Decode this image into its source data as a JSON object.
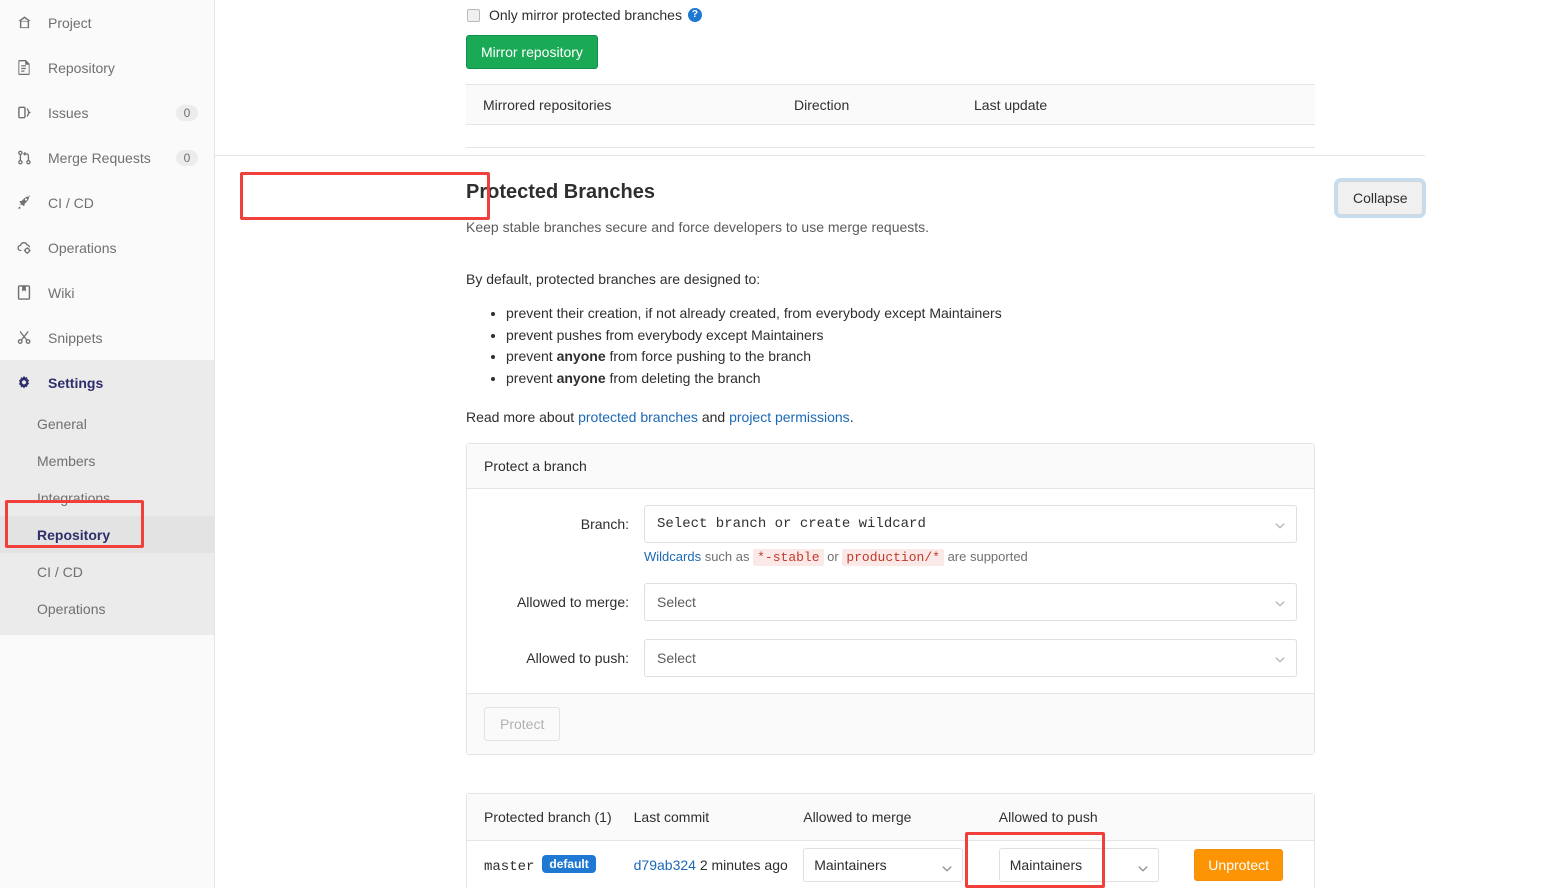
{
  "sidebar": {
    "items": [
      {
        "label": "Project",
        "icon": "home-icon",
        "badge": null
      },
      {
        "label": "Repository",
        "icon": "file-icon",
        "badge": null
      },
      {
        "label": "Issues",
        "icon": "issues-icon",
        "badge": "0"
      },
      {
        "label": "Merge Requests",
        "icon": "merge-request-icon",
        "badge": "0"
      },
      {
        "label": "CI / CD",
        "icon": "rocket-icon",
        "badge": null
      },
      {
        "label": "Operations",
        "icon": "cloud-gear-icon",
        "badge": null
      },
      {
        "label": "Wiki",
        "icon": "book-icon",
        "badge": null
      },
      {
        "label": "Snippets",
        "icon": "scissors-icon",
        "badge": null
      }
    ],
    "settings": {
      "label": "Settings",
      "icon": "gear-icon"
    },
    "subitems": [
      {
        "label": "General",
        "active": false
      },
      {
        "label": "Members",
        "active": false
      },
      {
        "label": "Integrations",
        "active": false
      },
      {
        "label": "Repository",
        "active": true
      },
      {
        "label": "CI / CD",
        "active": false
      },
      {
        "label": "Operations",
        "active": false
      }
    ]
  },
  "mirror": {
    "checkbox_label": "Only mirror protected branches",
    "help_glyph": "?",
    "button_label": "Mirror repository",
    "table_headers": [
      "Mirrored repositories",
      "Direction",
      "Last update"
    ]
  },
  "protected": {
    "title": "Protected Branches",
    "collapse_label": "Collapse",
    "subtitle": "Keep stable branches secure and force developers to use merge requests.",
    "lead": "By default, protected branches are designed to:",
    "rules": [
      {
        "pre": "prevent their creation, if not already created, from everybody except Maintainers",
        "strong": "",
        "post": ""
      },
      {
        "pre": "prevent pushes from everybody except Maintainers",
        "strong": "",
        "post": ""
      },
      {
        "pre": "prevent ",
        "strong": "anyone",
        "post": " from force pushing to the branch"
      },
      {
        "pre": "prevent ",
        "strong": "anyone",
        "post": " from deleting the branch"
      }
    ],
    "readmore": {
      "prefix": "Read more about ",
      "link1": "protected branches",
      "middle": " and ",
      "link2": "project permissions",
      "suffix": "."
    }
  },
  "protect_form": {
    "panel_title": "Protect a branch",
    "branch_label": "Branch:",
    "branch_value": "Select branch or create wildcard",
    "hint": {
      "link": "Wildcards",
      "mid1": " such as ",
      "code1": "*-stable",
      "mid2": " or ",
      "code2": "production/*",
      "mid3": " are supported"
    },
    "merge_label": "Allowed to merge:",
    "merge_value": "Select",
    "push_label": "Allowed to push:",
    "push_value": "Select",
    "submit_label": "Protect"
  },
  "branches_table": {
    "headers": [
      "Protected branch (1)",
      "Last commit",
      "Allowed to merge",
      "Allowed to push",
      ""
    ],
    "rows": [
      {
        "branch": "master",
        "badge": "default",
        "commit_sha": "d79ab324",
        "commit_time": " 2 minutes ago",
        "merge_access": "Maintainers",
        "push_access": "Maintainers",
        "action_label": "Unprotect"
      }
    ]
  },
  "colors": {
    "highlight_box": "#f1403c",
    "primary_green": "#1aaa55",
    "unprotect_orange": "#fc9403",
    "badge_blue": "#1f78d1",
    "link_blue": "#1b69b6",
    "active_nav_text": "#2e2e6b"
  }
}
